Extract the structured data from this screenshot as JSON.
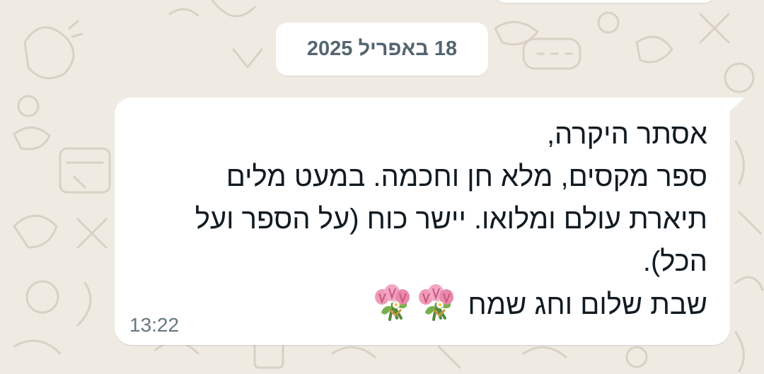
{
  "date_divider": "18 באפריל 2025",
  "message": {
    "lines": [
      "אסתר היקרה,",
      "ספר מקסים, מלא חן וחכמה. במעט מלים",
      "תיארת עולם ומלואו. יישר כוח (על הספר ועל",
      "הכל).",
      "שבת שלום וחג שמח"
    ],
    "emoji": [
      "bouquet-icon",
      "bouquet-icon"
    ],
    "time": "13:22"
  },
  "colors": {
    "wallpaper": "#efeae2",
    "bubble": "#ffffff",
    "text": "#111b21",
    "timestamp": "#667781"
  }
}
